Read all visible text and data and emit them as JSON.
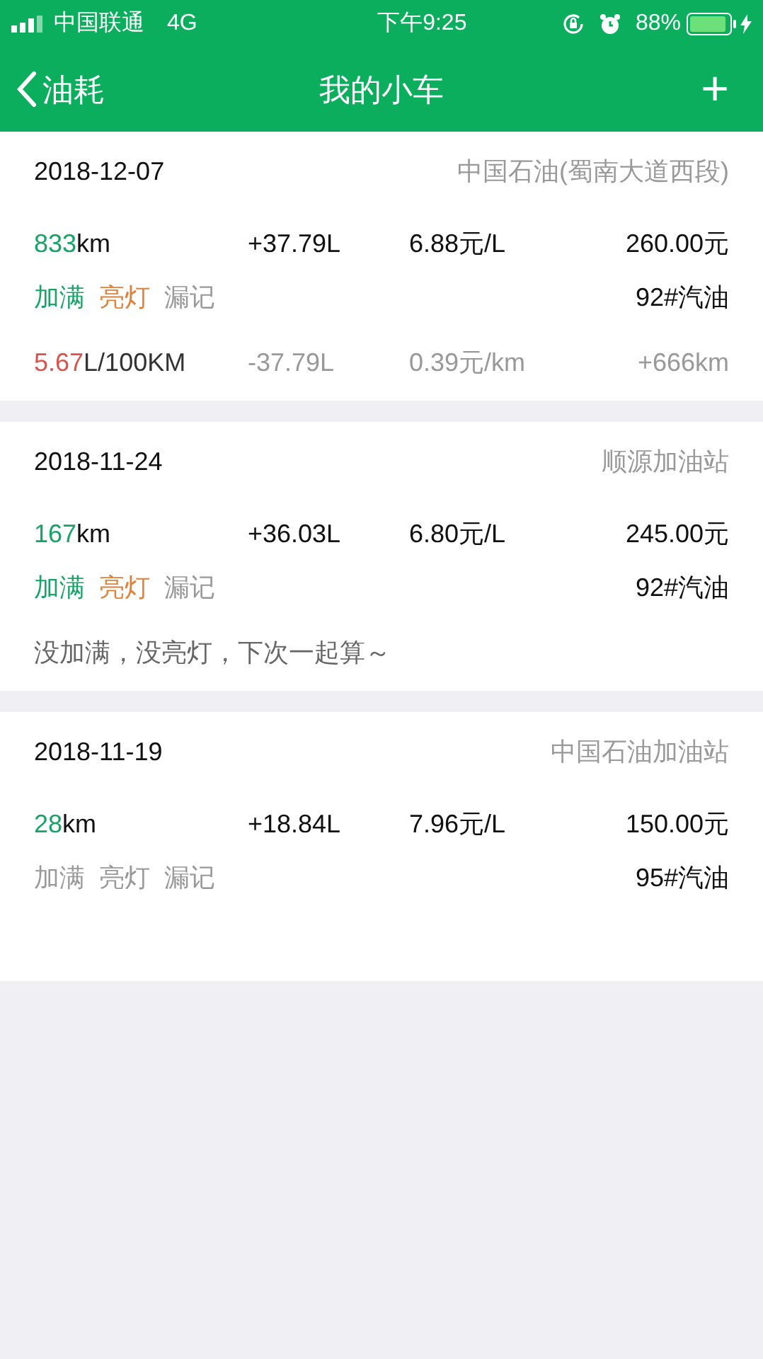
{
  "status_bar": {
    "carrier": "中国联通",
    "network": "4G",
    "time": "下午9:25",
    "battery": "88%"
  },
  "nav": {
    "back": "油耗",
    "title": "我的小车",
    "add": "+"
  },
  "records": [
    {
      "date": "2018-12-07",
      "station": "中国石油(蜀南大道西段)",
      "distance": {
        "value": "833",
        "unit": "km"
      },
      "volume": "+37.79L",
      "price": "6.88元/L",
      "amount": "260.00元",
      "tags": [
        {
          "kind": "full",
          "label": "加满",
          "on": true
        },
        {
          "kind": "light",
          "label": "亮灯",
          "on": true
        },
        {
          "kind": "missed",
          "label": "漏记",
          "on": false
        }
      ],
      "fuel": "92#汽油",
      "stats": {
        "consumption": {
          "value": "5.67",
          "unit": "L/100KM"
        },
        "used": "-37.79L",
        "cost_per_km": "0.39元/km",
        "distance_delta": "+666km"
      }
    },
    {
      "date": "2018-11-24",
      "station": "顺源加油站",
      "distance": {
        "value": "167",
        "unit": "km"
      },
      "volume": "+36.03L",
      "price": "6.80元/L",
      "amount": "245.00元",
      "tags": [
        {
          "kind": "full",
          "label": "加满",
          "on": true
        },
        {
          "kind": "light",
          "label": "亮灯",
          "on": true
        },
        {
          "kind": "missed",
          "label": "漏记",
          "on": false
        }
      ],
      "fuel": "92#汽油",
      "note": "没加满，没亮灯，下次一起算～"
    },
    {
      "date": "2018-11-19",
      "station": "中国石油加油站",
      "distance": {
        "value": "28",
        "unit": "km"
      },
      "volume": "+18.84L",
      "price": "7.96元/L",
      "amount": "150.00元",
      "tags": [
        {
          "kind": "full",
          "label": "加满",
          "on": false
        },
        {
          "kind": "light",
          "label": "亮灯",
          "on": false
        },
        {
          "kind": "missed",
          "label": "漏记",
          "on": false
        }
      ],
      "fuel": "95#汽油"
    }
  ]
}
